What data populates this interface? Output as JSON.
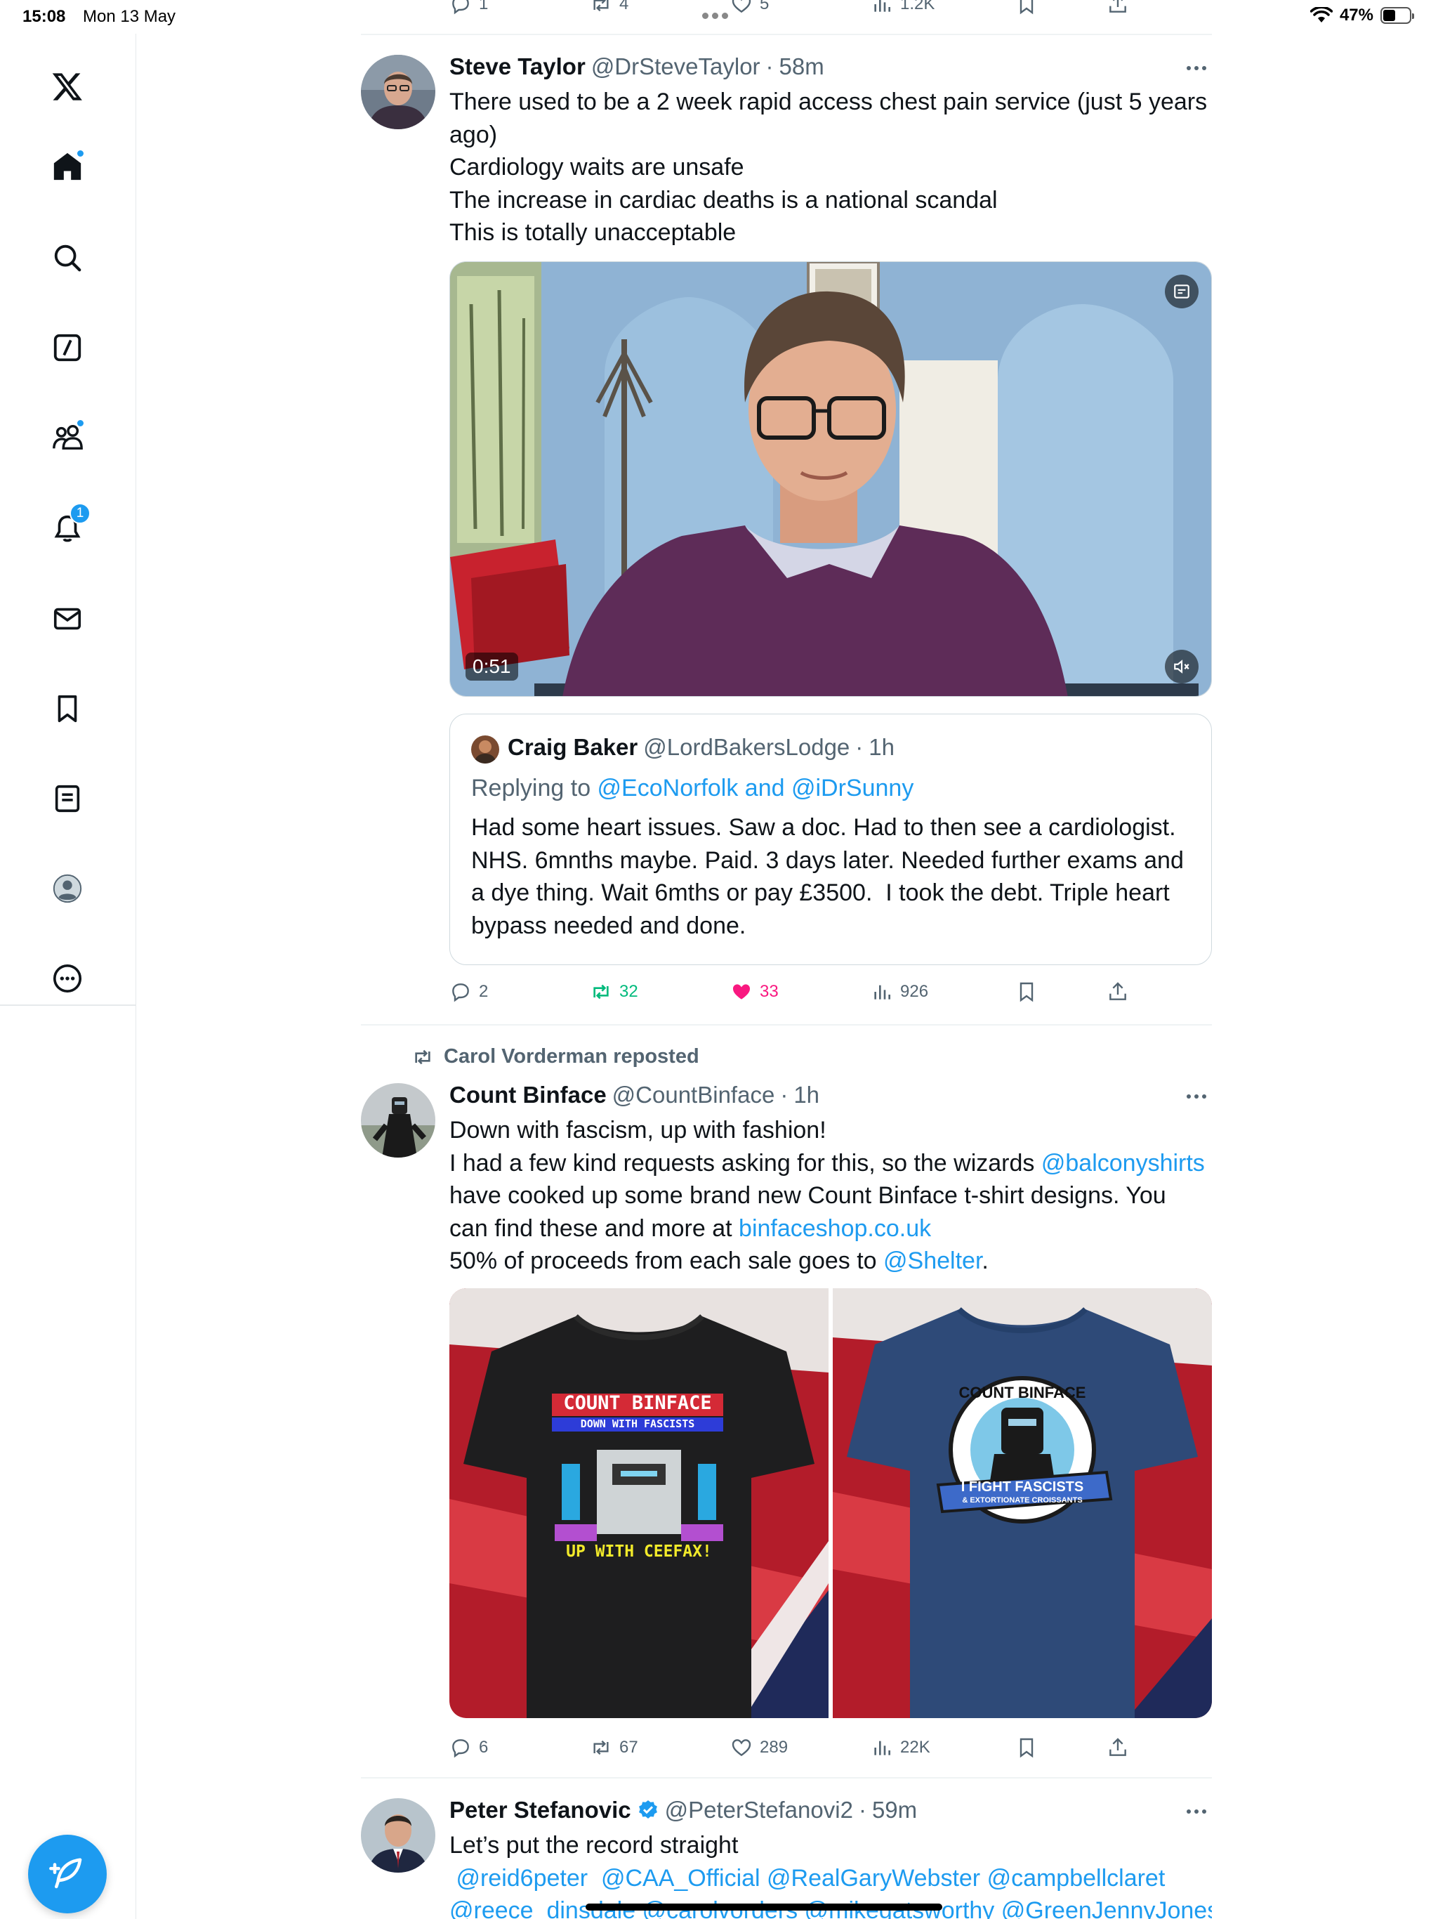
{
  "status_bar": {
    "time": "15:08",
    "date": "Mon 13 May",
    "battery": "47%",
    "battery_level": 0.47
  },
  "sidebar": {
    "items": [
      {
        "name": "logo",
        "icon": "x-logo-icon"
      },
      {
        "name": "home",
        "icon": "home-icon",
        "dot": true
      },
      {
        "name": "explore",
        "icon": "search-icon"
      },
      {
        "name": "grok",
        "icon": "grok-icon"
      },
      {
        "name": "communities",
        "icon": "communities-icon",
        "dot": true
      },
      {
        "name": "notifications",
        "icon": "bell-icon",
        "badge": "1"
      },
      {
        "name": "messages",
        "icon": "envelope-icon"
      },
      {
        "name": "bookmarks",
        "icon": "bookmark-icon"
      },
      {
        "name": "lists",
        "icon": "list-icon"
      },
      {
        "name": "profile",
        "icon": "profile-icon"
      },
      {
        "name": "more",
        "icon": "more-circle-icon"
      }
    ],
    "compose_icon": "compose-feather-icon"
  },
  "top_partial_actions": {
    "replies": "1",
    "reposts": "4",
    "likes": "5",
    "views": "1.2K"
  },
  "tweets": [
    {
      "name": "Steve Taylor",
      "handle": "@DrSteveTaylor",
      "sep": "·",
      "time": "58m",
      "lines": [
        "There used to be a 2 week rapid access chest pain service (just 5 years",
        "ago)",
        "Cardiology waits are unsafe",
        "The increase in cardiac deaths is a national scandal",
        "This is totally unacceptable"
      ],
      "video_duration": "0:51",
      "quote": {
        "name": "Craig Baker",
        "handle": "@LordBakersLodge",
        "sep": "·",
        "time": "1h",
        "replying_prefix": "Replying to ",
        "replying_to": "@EcoNorfolk and @iDrSunny",
        "lines": [
          "Had some heart issues. Saw a doc. Had to then see a cardiologist.",
          "NHS. 6mnths maybe. Paid. 3 days later. Needed further exams and",
          "a dye thing. Wait 6mths or pay £3500.  I took the debt. Triple heart",
          "bypass needed and done."
        ]
      },
      "actions": {
        "replies": "2",
        "reposts": "32",
        "likes": "33",
        "views": "926"
      }
    },
    {
      "reposted_by": "Carol Vorderman reposted",
      "name": "Count Binface",
      "handle": "@CountBinface",
      "sep": "·",
      "time": "1h",
      "text": {
        "l1": "Down with fascism, up with fashion!",
        "l2a": "I had a few kind requests asking for this, so the wizards ",
        "l2b": "@balconyshirts",
        "l3": "have cooked up some brand new Count Binface t-shirt designs. You",
        "l4a": "can find these and more at ",
        "l4b": "binfaceshop.co.uk",
        "l5a": "50% of proceeds from each sale goes to ",
        "l5b": "@Shelter",
        "l5c": "."
      },
      "shirt_left": {
        "l1": "COUNT BINFACE",
        "l2": "DOWN WITH FASCISTS",
        "l3": "UP WITH CEEFAX!"
      },
      "shirt_right": {
        "l1": "COUNT BINFACE",
        "l2": "I FIGHT FASCISTS",
        "l3": "& EXTORTIONATE CROISSANTS"
      },
      "actions": {
        "replies": "6",
        "reposts": "67",
        "likes": "289",
        "views": "22K"
      }
    },
    {
      "name": "Peter Stefanovic",
      "handle": "@PeterStefanovi2",
      "sep": "·",
      "time": "59m",
      "line1": "Let’s put the record straight",
      "mentions1": " @reid6peter  @CAA_Official @RealGaryWebster @campbellclaret",
      "mentions2": "@reece_dinsdale @carolvorders @mikegatsworthy @GreenJennyJones"
    }
  ]
}
